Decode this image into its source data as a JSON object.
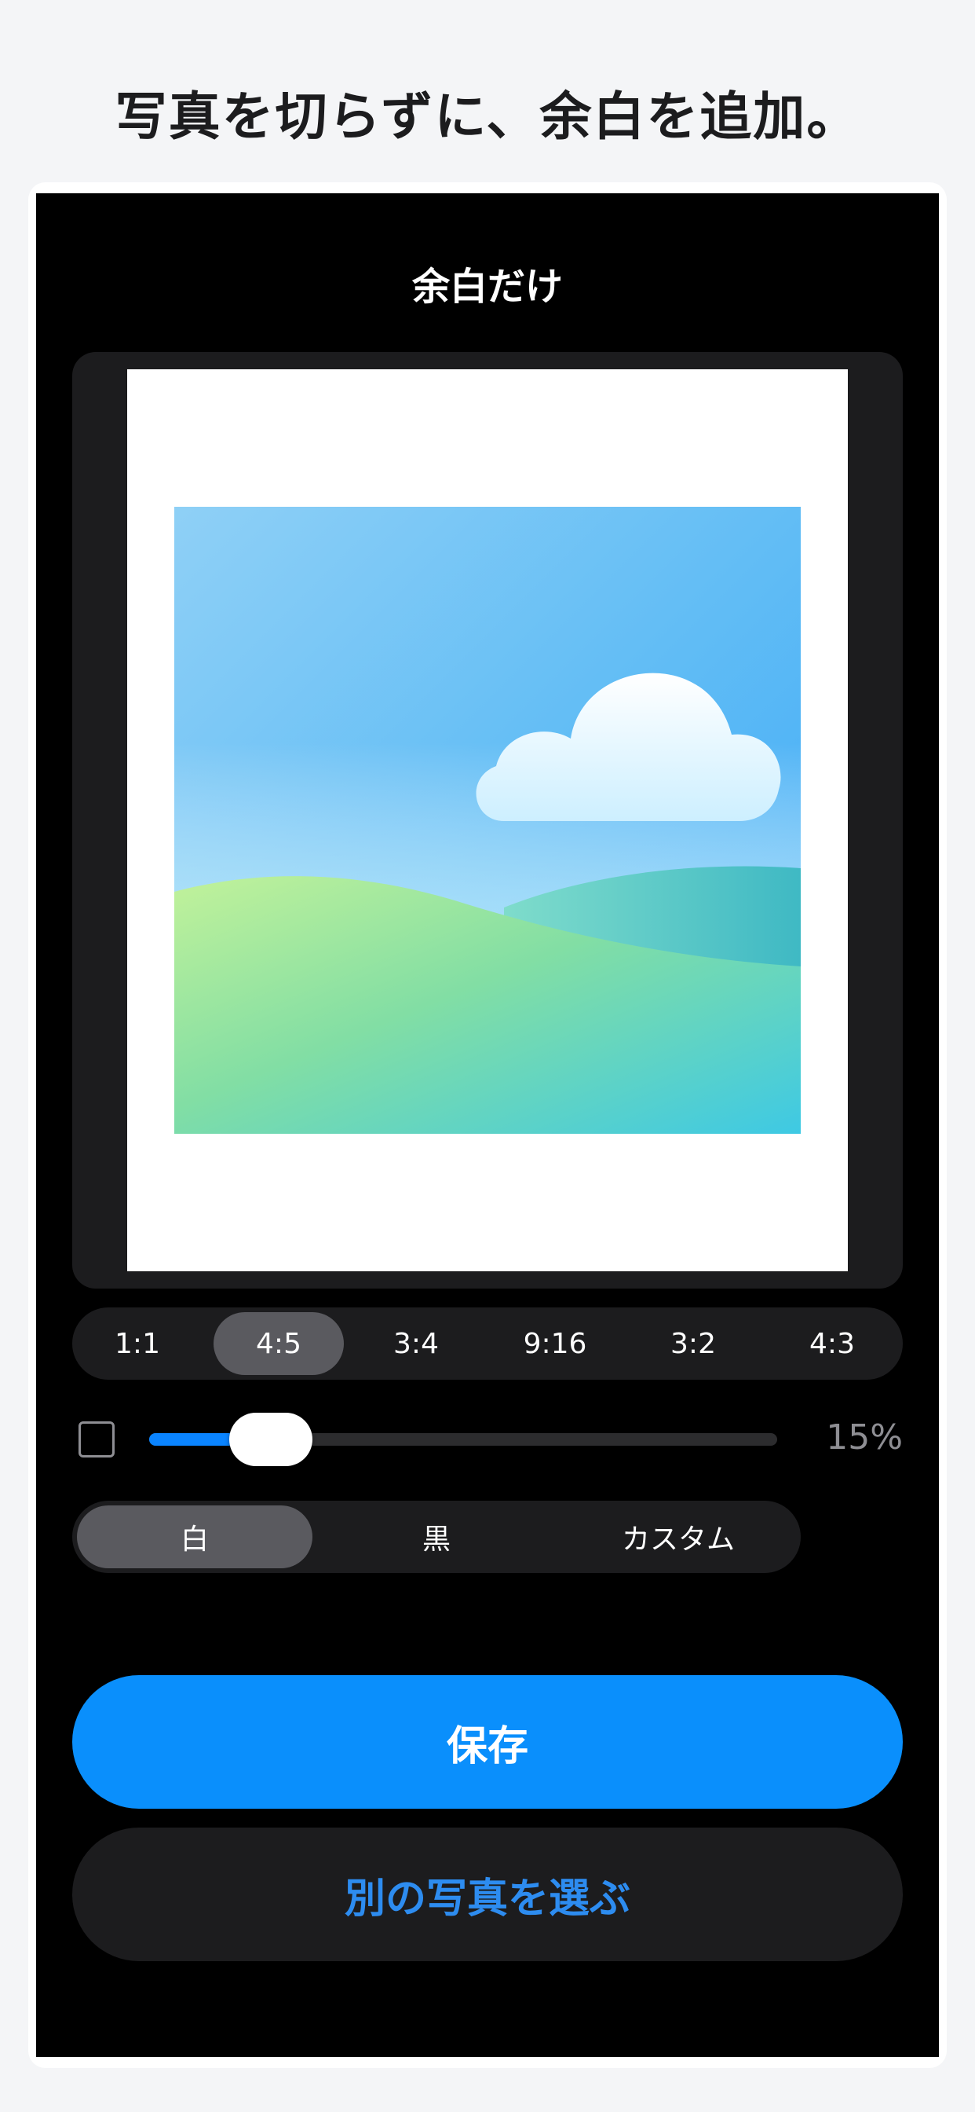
{
  "headline": "写真を切らずに、余白を追加。",
  "screen": {
    "title": "余白だけ"
  },
  "preview": {
    "photo_icon": "landscape-cloud-hills-illustration",
    "canvas_color": "#ffffff"
  },
  "aspect_ratios": {
    "items": [
      "1:1",
      "4:5",
      "3:4",
      "9:16",
      "3:2",
      "4:3"
    ],
    "selected": "4:5"
  },
  "border": {
    "checkbox_checked": false,
    "slider_percent": 15,
    "value_label": "15%"
  },
  "border_color": {
    "options": [
      "白",
      "黒",
      "カスタム"
    ],
    "selected": "白"
  },
  "actions": {
    "save_label": "保存",
    "pick_label": "別の写真を選ぶ"
  },
  "colors": {
    "accent": "#0a8ffc",
    "screen_bg": "#000000",
    "panel_bg": "#1c1c1e",
    "selected_bg": "#5a5a5f"
  }
}
